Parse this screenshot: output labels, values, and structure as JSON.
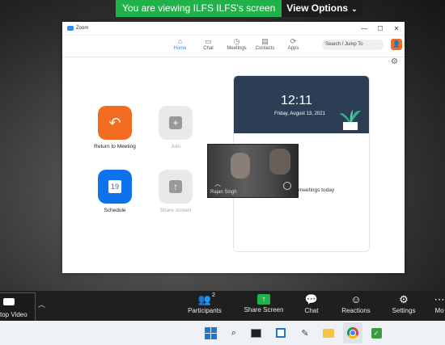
{
  "banner": {
    "viewing_text": "You are viewing ILFS ILFS's screen",
    "view_options": "View Options"
  },
  "window": {
    "title": "Zoom",
    "nav": [
      {
        "label": "Home",
        "icon": "home-icon",
        "glyph": "⌂",
        "active": true
      },
      {
        "label": "Chat",
        "icon": "chat-icon",
        "glyph": "▭",
        "active": false
      },
      {
        "label": "Meetings",
        "icon": "clock-icon",
        "glyph": "◷",
        "active": false
      },
      {
        "label": "Contacts",
        "icon": "contacts-icon",
        "glyph": "▤",
        "active": false
      },
      {
        "label": "Apps",
        "icon": "apps-icon",
        "glyph": "⟳",
        "active": false
      }
    ],
    "search_placeholder": "Search / Jump To",
    "tiles": {
      "return": "Return to Meeting",
      "join": "Join",
      "schedule": "Schedule",
      "schedule_day": "19",
      "share": "Share screen"
    },
    "card": {
      "time": "12:11",
      "date": "Friday, August 13, 2021",
      "message": "meetings today"
    }
  },
  "video": {
    "participant_name": "Rajan Singh"
  },
  "toolbar": {
    "stop_video": "top Video",
    "participants": "Participants",
    "participants_count": "2",
    "share_screen": "Share Screen",
    "chat": "Chat",
    "reactions": "Reactions",
    "settings": "Settings",
    "more": "Mo"
  },
  "colors": {
    "accent": "#2d8cff",
    "orange": "#f26d21",
    "share_green": "#21b14a"
  }
}
